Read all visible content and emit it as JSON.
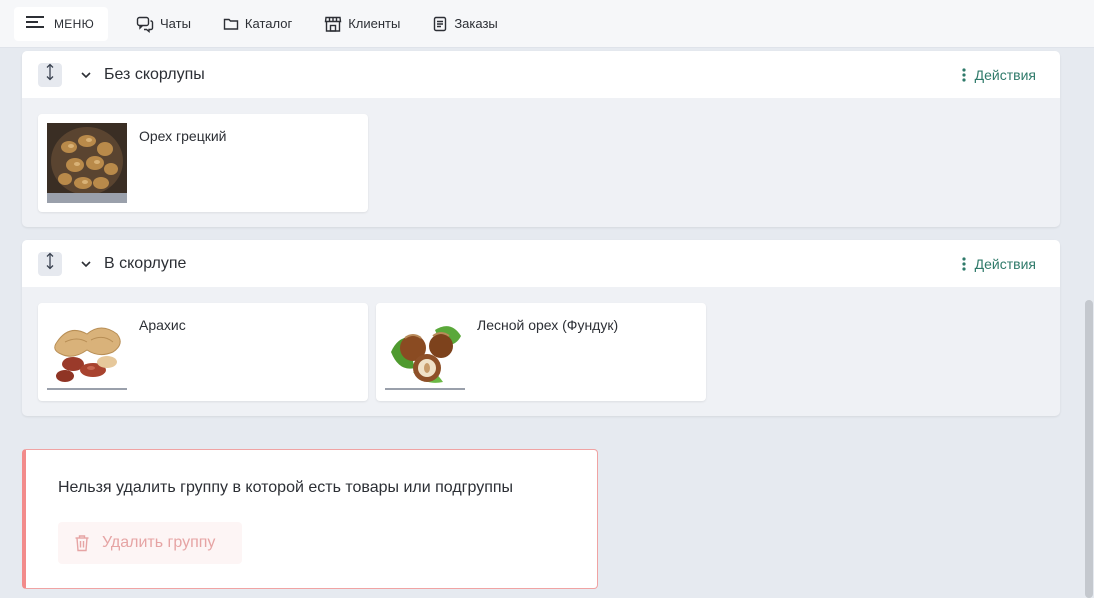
{
  "header": {
    "menu_label": "МЕНЮ",
    "nav": [
      {
        "label": "Чаты",
        "icon": "chat-icon"
      },
      {
        "label": "Каталог",
        "icon": "folder-icon"
      },
      {
        "label": "Клиенты",
        "icon": "store-icon"
      },
      {
        "label": "Заказы",
        "icon": "document-icon"
      }
    ]
  },
  "groups": [
    {
      "title": "Без скорлупы",
      "actions_label": "Действия",
      "products": [
        {
          "name": "Орех грецкий",
          "image": "walnut-photo"
        }
      ]
    },
    {
      "title": "В скорлупе",
      "actions_label": "Действия",
      "products": [
        {
          "name": "Арахис",
          "image": "peanut-photo"
        },
        {
          "name": "Лесной орех (Фундук)",
          "image": "hazelnut-photo"
        }
      ]
    }
  ],
  "warning": {
    "message": "Нельзя удалить группу в которой есть товары или подгруппы",
    "delete_label": "Удалить группу"
  },
  "colors": {
    "accent": "#2f7a6a",
    "danger_border": "#f28b8b",
    "danger_text": "#e6a4a4",
    "background": "#e6eaf0"
  }
}
